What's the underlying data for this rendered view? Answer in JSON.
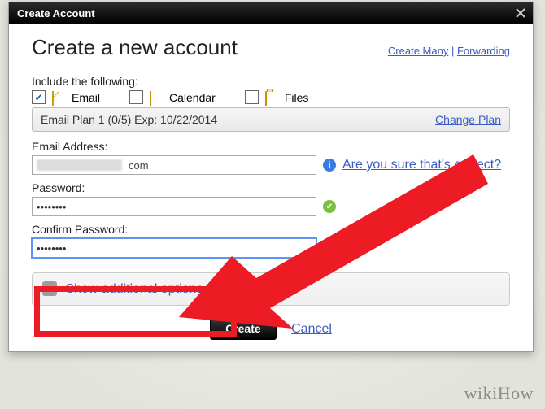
{
  "dialog": {
    "title": "Create Account",
    "heading": "Create a new account",
    "top_links": {
      "create_many": "Create Many",
      "forwarding": "Forwarding"
    },
    "include_label": "Include the following:",
    "features": {
      "email": {
        "label": "Email",
        "checked": true
      },
      "calendar": {
        "label": "Calendar",
        "checked": false
      },
      "files": {
        "label": "Files",
        "checked": false
      }
    },
    "plan": {
      "text": "Email Plan 1 (0/5) Exp: 10/22/2014",
      "change": "Change Plan"
    },
    "fields": {
      "email": {
        "label": "Email Address:",
        "domain_suffix": "com",
        "help": "Are you sure that's correct?"
      },
      "password": {
        "label": "Password:",
        "value": "••••••••"
      },
      "confirm": {
        "label": "Confirm Password:",
        "value": "••••••••"
      }
    },
    "additional": {
      "toggle": "Show additional options"
    },
    "buttons": {
      "create": "Create",
      "cancel": "Cancel"
    }
  },
  "watermark": "wikiHow"
}
